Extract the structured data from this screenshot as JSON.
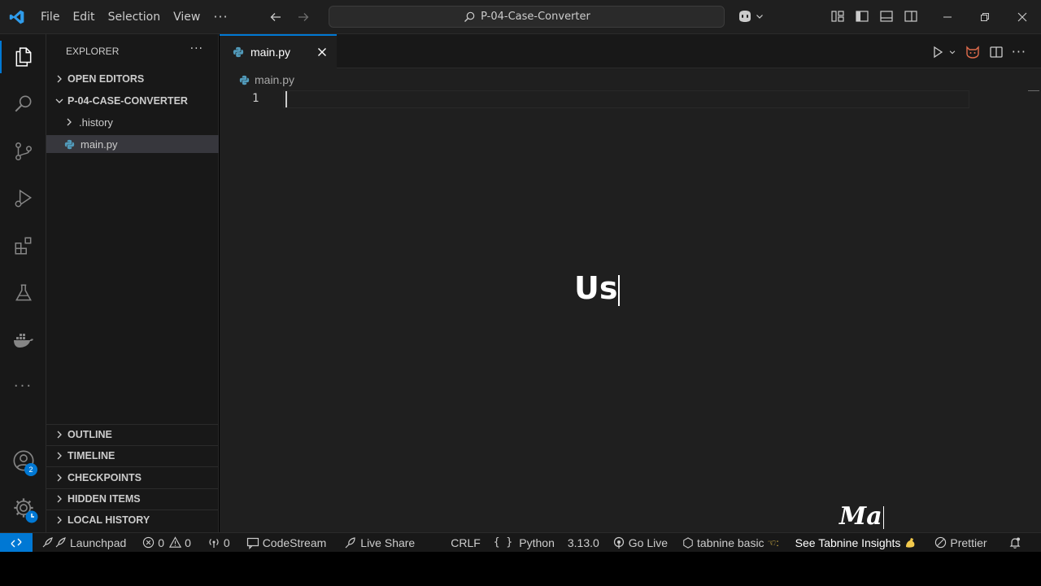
{
  "titlebar": {
    "menu": [
      "File",
      "Edit",
      "Selection",
      "View"
    ],
    "menu_more": "···",
    "search": "P-04-Case-Converter"
  },
  "explorer": {
    "header": "EXPLORER",
    "more": "···",
    "open_editors": "OPEN EDITORS",
    "project": "P-04-CASE-CONVERTER",
    "folder_history": ".history",
    "file_main": "main.py",
    "sections": [
      "OUTLINE",
      "TIMELINE",
      "CHECKPOINTS",
      "HIDDEN ITEMS",
      "LOCAL HISTORY"
    ]
  },
  "activity": {
    "accounts_badge": "2"
  },
  "editor": {
    "tab_label": "main.py",
    "breadcrumb": "main.py",
    "line_number": "1",
    "overlay_large": "Us",
    "overlay_small": "Ma"
  },
  "statusbar": {
    "launchpad": "Launchpad",
    "errors": "0",
    "warnings": "0",
    "ports": "0",
    "codestream": "CodeStream",
    "liveshare": "Live Share",
    "eol": "CRLF",
    "language": "Python",
    "version": "3.13.0",
    "golive": "Go Live",
    "tabnine": "tabnine basic",
    "tabnine_insights": "See Tabnine Insights",
    "prettier": "Prettier"
  },
  "colors": {
    "accent": "#0078d4",
    "python_blue": "#519aba",
    "editor_bg": "#1f1f1f",
    "sidebar_bg": "#181818"
  }
}
